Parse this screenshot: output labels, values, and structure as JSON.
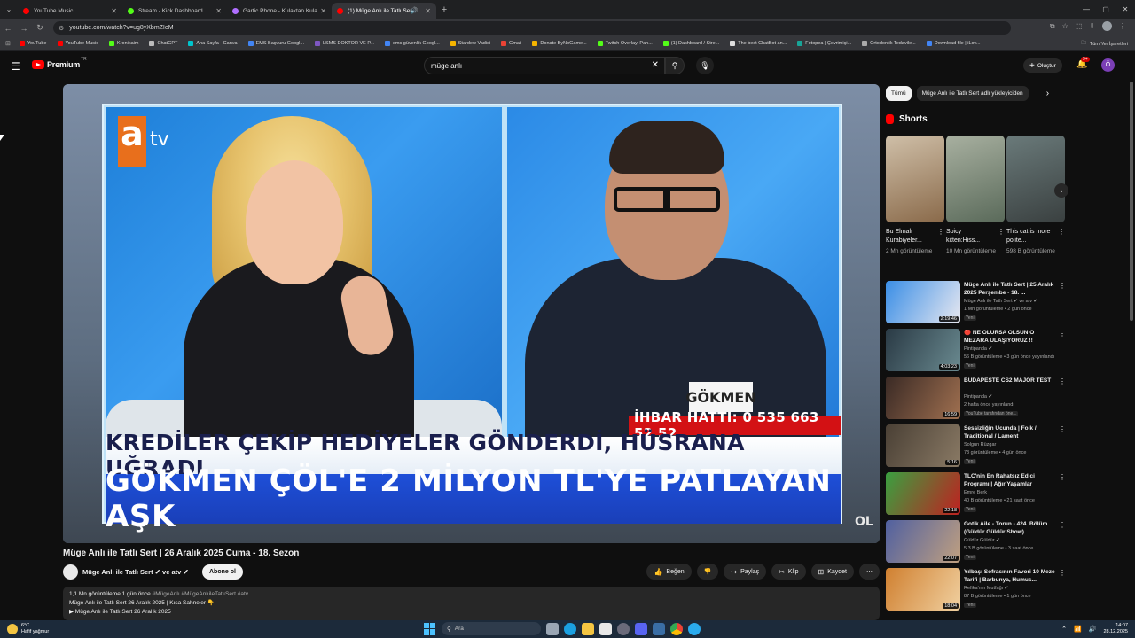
{
  "browser": {
    "tabs": [
      {
        "title": "YouTube Music",
        "color": "#ff0000",
        "active": false
      },
      {
        "title": "Stream - Kick Dashboard",
        "color": "#53fc18",
        "active": false
      },
      {
        "title": "Gartic Phone - Kulaktan Kulağa",
        "color": "#b06fff",
        "active": false
      },
      {
        "title": "(1) Müge Anlı ile Tatlı Sert |",
        "color": "#ff0000",
        "active": true
      }
    ],
    "url": "youtube.com/watch?v=ug8yXbmZIeM",
    "bookmarks": [
      {
        "label": "YouTube",
        "color": "#ff0000"
      },
      {
        "label": "YouTube Music",
        "color": "#ff0000"
      },
      {
        "label": "Kronikaim",
        "color": "#53fc18"
      },
      {
        "label": "ChatGPT",
        "color": "#bbbbbb"
      },
      {
        "label": "Ana Sayfa - Canva",
        "color": "#00c4cc"
      },
      {
        "label": "EMS Başvuru Googl...",
        "color": "#4285f4"
      },
      {
        "label": "LSMS DOKTOR VE P...",
        "color": "#7e57c2"
      },
      {
        "label": "ems güvenlik Googl...",
        "color": "#4285f4"
      },
      {
        "label": "Stardew Vadisi",
        "color": "#f4b400"
      },
      {
        "label": "Gmail",
        "color": "#ea4335"
      },
      {
        "label": "Donate ByNoGame...",
        "color": "#f4b400"
      },
      {
        "label": "Twitch Overlay, Pan...",
        "color": "#53fc18"
      },
      {
        "label": "(1) Dashboard / Stre...",
        "color": "#53fc18"
      },
      {
        "label": "The best ChatBot an...",
        "color": "#dddddd"
      },
      {
        "label": "Fotopea | Çevrimiçi...",
        "color": "#18a497"
      },
      {
        "label": "Ortodontik Tedavile...",
        "color": "#aaaaaa"
      },
      {
        "label": "Download file | iLov...",
        "color": "#4285f4"
      }
    ],
    "bookmarks_all": "Tüm Yer İşaretleri"
  },
  "youtube": {
    "logo_text": "Premium",
    "logo_country": "TR",
    "search_value": "müge anlı",
    "create_label": "Oluştur",
    "notif_count": "9+",
    "avatar_letter": "Ö"
  },
  "video": {
    "channel_logo_letter": "a",
    "channel_logo_suffix": "tv",
    "name_tag": "GÖKMEN",
    "hotline": "İHBAR HATTI: 0 535 663 52 52",
    "banner_top": "KREDİLER ÇEKİP HEDİYELER GÖNDERDİ, HÜSRANA UĞRADI",
    "banner_bottom": "GÖKMEN ÇÖL'E 2 MİLYON TL'YE PATLAYAN AŞK",
    "watermark": "OL",
    "title": "Müge Anlı ile Tatlı Sert | 26 Aralık 2025 Cuma - 18. Sezon",
    "channel": "Müge Anlı ile Tatlı Sert ✔ ve atv ✔",
    "subscribe_label": "Abone ol",
    "actions": {
      "like": "Beğen",
      "share": "Paylaş",
      "clip": "Klip",
      "save": "Kaydet"
    },
    "description": {
      "stats": "1,1 Mn görüntüleme  1 gün önce",
      "tags": "#MügeAnlı #MügeAnlıileTatlıSert #atv",
      "line2": "Müge Anlı ile Tatlı Sert 26 Aralık 2025 | Kısa Sahneler 👇",
      "line3": "▶ Müge Anlı ile Tatlı Sert 26 Aralık 2025"
    }
  },
  "sidebar": {
    "chips": [
      {
        "label": "Tümü",
        "selected": true
      },
      {
        "label": "Müge Anlı ile Tatlı Sert adlı yükleyiciden",
        "selected": false
      }
    ],
    "shorts_title": "Shorts",
    "shorts": [
      {
        "title": "Bu Elmalı Kurabiyeler...",
        "views": "2 Mn görüntüleme",
        "colors": [
          "#cfbfa8",
          "#8a6a4a"
        ]
      },
      {
        "title": "Spicy kitten:Hiss...",
        "views": "10 Mn görüntüleme",
        "colors": [
          "#a8b0a0",
          "#5a6a5a"
        ]
      },
      {
        "title": "This cat is more polite...",
        "views": "598 B görüntüleme",
        "colors": [
          "#6a7a7a",
          "#3a4040"
        ]
      }
    ],
    "videos": [
      {
        "title": "Müge Anlı ile Tatlı Sert | 25 Aralık 2025 Perşembe - 18. ...",
        "channel": "Müge Anlı ile Tatlı Sert ✔ ve atv ✔",
        "meta": "1 Mn görüntüleme • 2 gün önce",
        "badge": "Yeni",
        "duration": "2:19:46",
        "colors": [
          "#3a8ee6",
          "#e8e8f0"
        ]
      },
      {
        "title": "🔴 NE OLURSA OLSUN O MEZARA ULAŞIYORUZ !!",
        "channel": "Pintipanda ✔",
        "meta": "56 B görüntüleme • 3 gün önce yayınlandı",
        "badge": "Yeni",
        "duration": "4:03:23",
        "colors": [
          "#2a3a45",
          "#6a8a90"
        ]
      },
      {
        "title": "BUDAPESTE CS2 MAJOR TEST",
        "channel": "Pintipanda ✔",
        "meta": "2 hafta önce yayınlandı",
        "badge": "YouTube tarafından öne...",
        "duration": "16:59",
        "colors": [
          "#3a2a25",
          "#a07050"
        ]
      },
      {
        "title": "Sessizliğin Ucunda | Folk / Traditional / Lament",
        "channel": "Solgun Rüzgar",
        "meta": "73 görüntüleme • 4 gün önce",
        "badge": "Yeni",
        "duration": "5:16",
        "colors": [
          "#4a4035",
          "#8a7a65"
        ]
      },
      {
        "title": "TLC'nin En Rahatsız Edici Programı | Ağır Yaşamlar",
        "channel": "Emre Berk",
        "meta": "40 B görüntüleme • 21 saat önce",
        "badge": "Yeni",
        "duration": "22:18",
        "colors": [
          "#3aa040",
          "#c02020"
        ]
      },
      {
        "title": "Gotik Aile - Torun - 424. Bölüm (Güldür Güldür Show)",
        "channel": "Güldür Güldür ✔",
        "meta": "5,3 B görüntüleme • 3 saat önce",
        "badge": "Yeni",
        "duration": "22:07",
        "colors": [
          "#5060a0",
          "#c0a080"
        ]
      },
      {
        "title": "Yılbaşı Sofrasının Favori 10 Meze Tarifi | Barbunya, Humus...",
        "channel": "Refika'nın Mutfağı ✔",
        "meta": "87 B görüntüleme • 1 gün önce",
        "badge": "Yeni",
        "duration": "18:04",
        "colors": [
          "#d08030",
          "#f0d0a0"
        ]
      }
    ]
  },
  "taskbar": {
    "weather_temp": "6°C",
    "weather_desc": "Hafif yağmur",
    "search_placeholder": "Ara",
    "time": "14:07",
    "date": "28.12.2025"
  }
}
